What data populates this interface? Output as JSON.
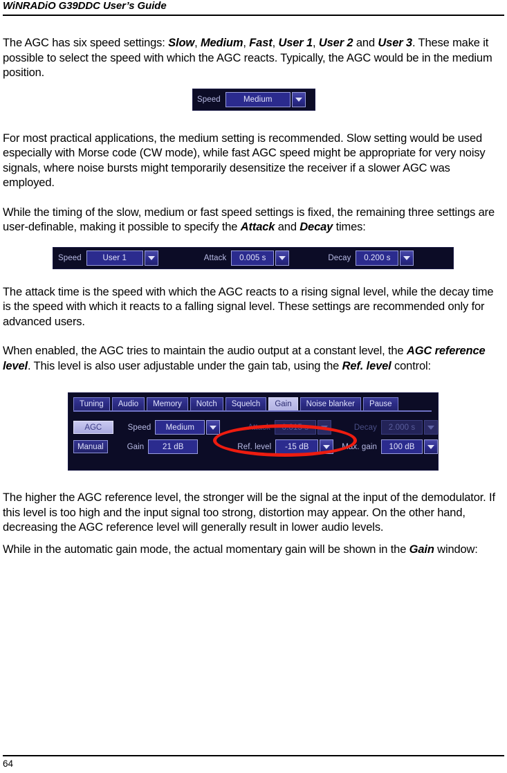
{
  "header": {
    "running_title": "WiNRADiO G39DDC User’s Guide"
  },
  "footer": {
    "page_number": "64"
  },
  "body": {
    "p1_a": "The AGC has six speed settings: ",
    "p1_slow": "Slow",
    "p1_c1": ", ",
    "p1_medium": "Medium",
    "p1_c2": ", ",
    "p1_fast": "Fast",
    "p1_c3": ", ",
    "p1_user1": "User 1",
    "p1_c4": ", ",
    "p1_user2": "User 2",
    "p1_and": " and ",
    "p1_user3": "User 3",
    "p1_tail": ". These make it possible to select the speed with which the AGC reacts. Typically, the AGC would be in the medium position.",
    "p2": "For most practical applications, the medium setting is recommended. Slow setting would be used especially with Morse code (CW mode), while fast AGC speed might be appropriate for very noisy signals, where noise bursts might temporarily desensitize the receiver if a slower AGC was employed.",
    "p3_a": "While the timing of the slow, medium or fast speed settings is fixed, the remaining three settings are user-definable, making it possible to specify the ",
    "p3_attack": "Attack",
    "p3_and": " and ",
    "p3_decay": "Decay",
    "p3_tail": " times:",
    "p4": "The attack time is the speed with which the AGC reacts to a rising signal level, while the decay time is the speed with which it reacts to a falling signal level. These settings are recommended only for advanced users.",
    "p5_a": "When enabled, the AGC tries to maintain the audio output at a constant level, the ",
    "p5_ref": "AGC reference level",
    "p5_b": ". This level is also user adjustable under the gain tab, using the ",
    "p5_ctrl": "Ref. level",
    "p5_tail": " control:",
    "p6": "The higher the AGC reference level, the stronger will be the signal at the input of the demodulator. If this level is too high and the input signal too strong, distortion may appear. On the other hand, decreasing the AGC reference level will generally result in lower audio levels.",
    "p7_a": "While in the automatic gain mode, the actual momentary gain will be shown in the ",
    "p7_gain": "Gain",
    "p7_tail": " window:"
  },
  "figure_speed": {
    "speed_label": "Speed",
    "speed_value": "Medium",
    "dropdown_icon": "chevron-down-icon"
  },
  "figure_user": {
    "speed_label": "Speed",
    "speed_value": "User 1",
    "attack_label": "Attack",
    "attack_value": "0.005 s",
    "decay_label": "Decay",
    "decay_value": "0.200 s",
    "dropdown_icon": "chevron-down-icon"
  },
  "figure_gain_panel": {
    "tabs": [
      {
        "label": "Tuning",
        "active": false
      },
      {
        "label": "Audio",
        "active": false
      },
      {
        "label": "Memory",
        "active": false
      },
      {
        "label": "Notch",
        "active": false
      },
      {
        "label": "Squelch",
        "active": false
      },
      {
        "label": "Gain",
        "active": true
      },
      {
        "label": "Noise blanker",
        "active": false
      },
      {
        "label": "Pause",
        "active": false
      }
    ],
    "mode_agc": "AGC",
    "mode_manual": "Manual",
    "speed_label": "Speed",
    "speed_value": "Medium",
    "gain_label": "Gain",
    "gain_value": "21 dB",
    "attack_label": "Attack",
    "attack_value": "0.015 s",
    "decay_label": "Decay",
    "decay_value": "2.000 s",
    "ref_level_label": "Ref. level",
    "ref_level_value": "-15 dB",
    "max_gain_label": "Max. gain",
    "max_gain_value": "100 dB",
    "annotation_color": "#ed1c10",
    "dropdown_icon": "chevron-down-icon"
  }
}
